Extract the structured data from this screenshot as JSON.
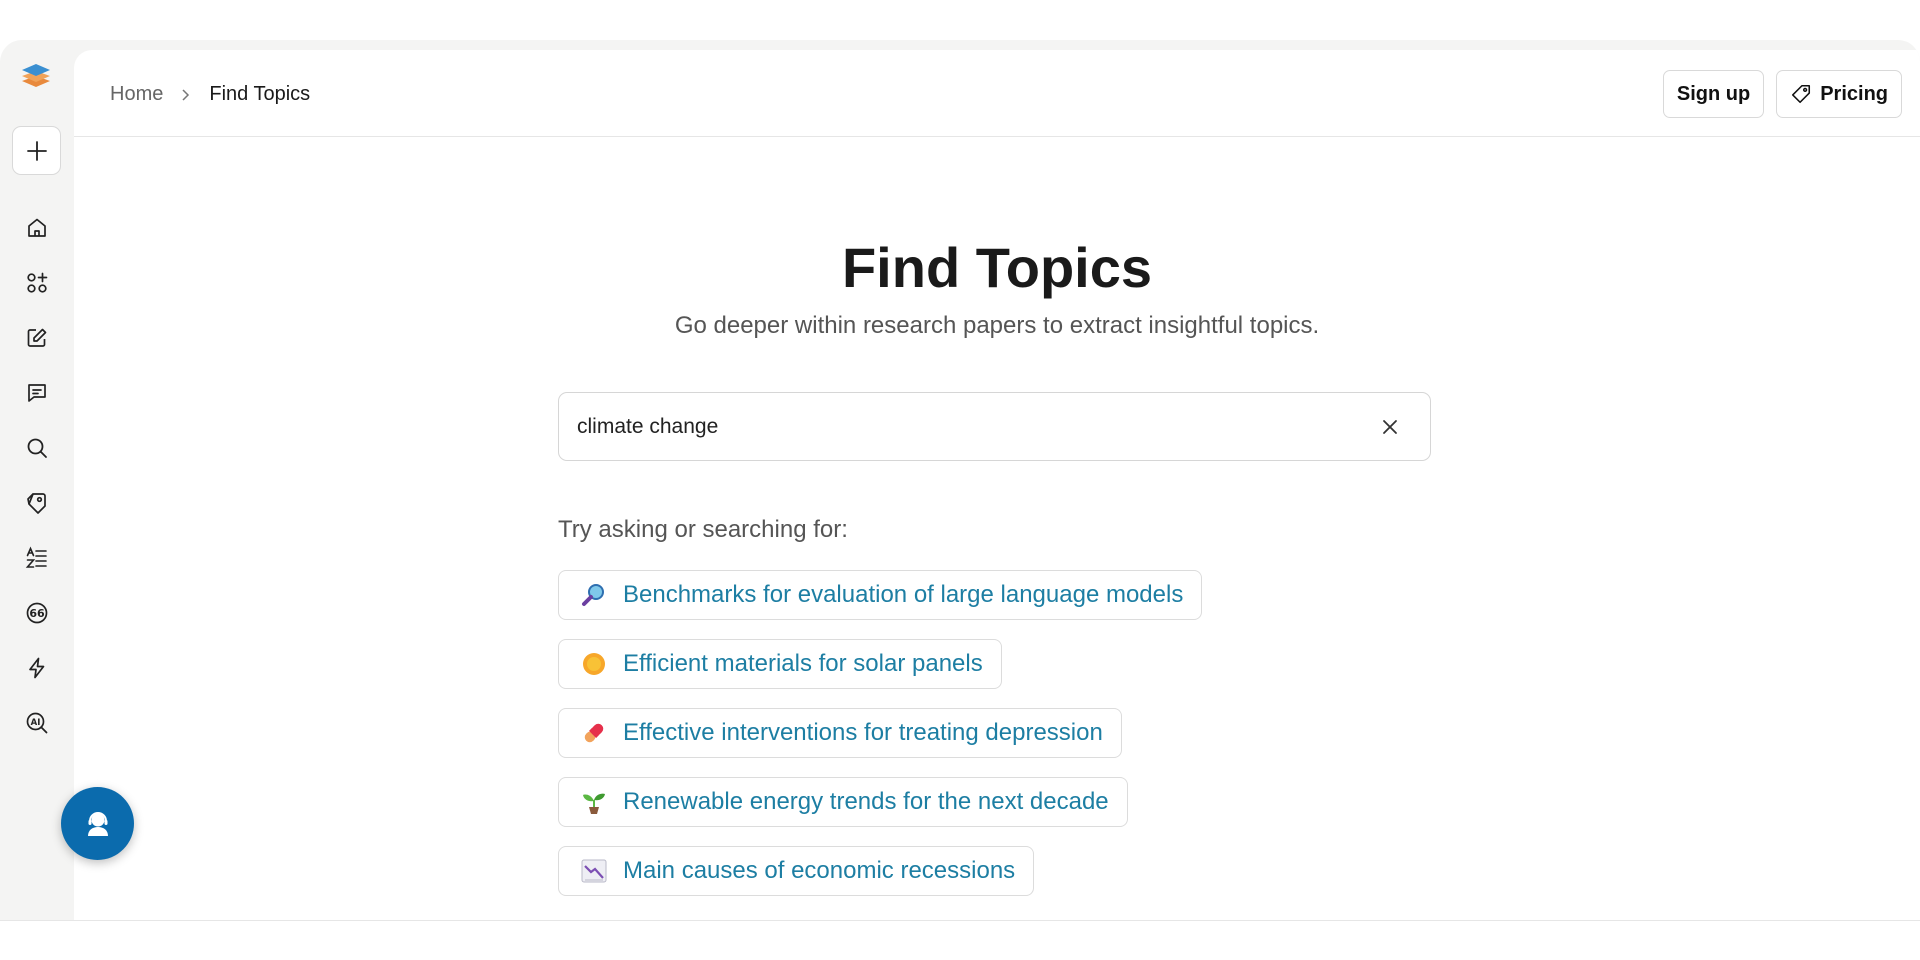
{
  "breadcrumb": {
    "home": "Home",
    "current": "Find Topics"
  },
  "header": {
    "signup_label": "Sign up",
    "pricing_label": "Pricing"
  },
  "sidebar": {
    "items": [
      {
        "name": "home-icon"
      },
      {
        "name": "apps-add-icon"
      },
      {
        "name": "edit-icon"
      },
      {
        "name": "chat-icon"
      },
      {
        "name": "search-icon"
      },
      {
        "name": "tag-icon"
      },
      {
        "name": "sort-list-icon"
      },
      {
        "name": "quote-icon"
      },
      {
        "name": "lightning-icon"
      },
      {
        "name": "ai-search-icon"
      }
    ]
  },
  "main": {
    "title": "Find Topics",
    "subtitle": "Go deeper within research papers to extract insightful topics.",
    "search": {
      "value": "climate change",
      "placeholder": ""
    },
    "try_label": "Try asking or searching for:",
    "suggestions": [
      {
        "icon": "magnifier-emoji",
        "text": "Benchmarks for evaluation of large language models"
      },
      {
        "icon": "sun-emoji",
        "text": "Efficient materials for solar panels"
      },
      {
        "icon": "pill-emoji",
        "text": "Effective interventions for treating depression"
      },
      {
        "icon": "seedling-emoji",
        "text": "Renewable energy trends for the next decade"
      },
      {
        "icon": "chart-decreasing-emoji",
        "text": "Main causes of economic recessions"
      }
    ]
  },
  "colors": {
    "accent_link": "#1d7ea3",
    "support_button": "#0b6bad"
  }
}
